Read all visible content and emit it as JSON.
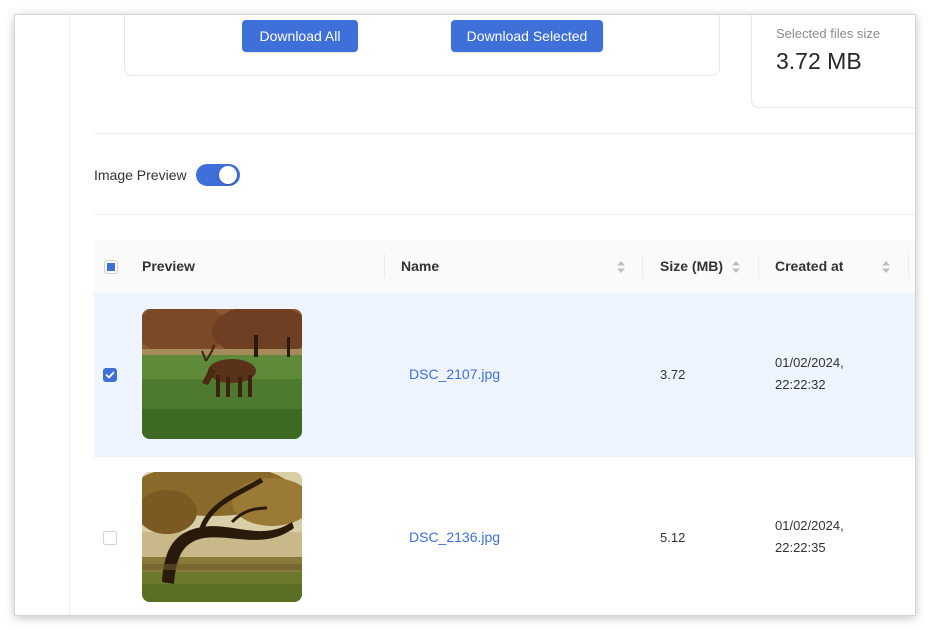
{
  "download": {
    "download_all_label": "Download All",
    "download_selected_label": "Download Selected"
  },
  "stats": {
    "selected_size_label": "Selected files size",
    "selected_size_value": "3.72 MB"
  },
  "preview_toggle": {
    "label": "Image Preview",
    "enabled": true
  },
  "table": {
    "columns": [
      "Preview",
      "Name",
      "Size (MB)",
      "Created at"
    ],
    "header_checkbox_state": "indeterminate",
    "rows": [
      {
        "name": "DSC_2107.jpg",
        "size": "3.72",
        "created_date": "01/02/2024,",
        "created_time": "22:22:32",
        "selected": true,
        "thumbnail_icon": "deer-photo-icon"
      },
      {
        "name": "DSC_2136.jpg",
        "size": "5.12",
        "created_date": "01/02/2024,",
        "created_time": "22:22:35",
        "selected": false,
        "thumbnail_icon": "tree-photo-icon"
      }
    ]
  },
  "colors": {
    "accent": "#3f6fd8",
    "selected_row": "#eef5ff",
    "link": "#3f6fd8"
  }
}
